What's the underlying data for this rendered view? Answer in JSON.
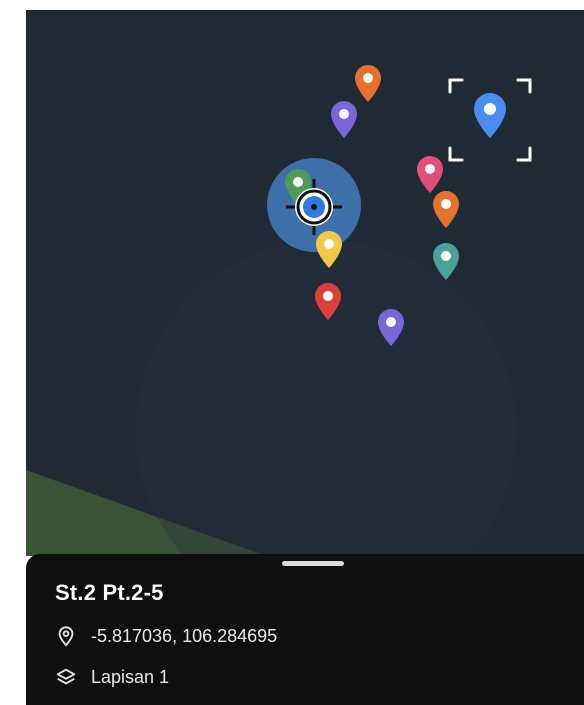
{
  "map": {
    "markers": [
      {
        "color": "#e6722e"
      },
      {
        "color": "#7a66d6"
      },
      {
        "color": "#4a8cf0",
        "selected": true
      },
      {
        "color": "#4f9a57"
      },
      {
        "color": "#e24e7a"
      },
      {
        "color": "#e6722e"
      },
      {
        "color": "#f2c84b"
      },
      {
        "color": "#4aa39a"
      },
      {
        "color": "#d8403a"
      },
      {
        "color": "#7a66d6"
      }
    ],
    "current_location_icon": "crosshair-location-icon",
    "accent_circle": "#3f6fa8",
    "land_color": "#3a5236"
  },
  "bottom_sheet": {
    "title": "St.2 Pt.2-5",
    "coordinates": "-5.817036, 106.284695",
    "coordinates_icon": "location-pin-icon",
    "layer": "Lapisan 1",
    "layer_icon": "layers-icon"
  }
}
